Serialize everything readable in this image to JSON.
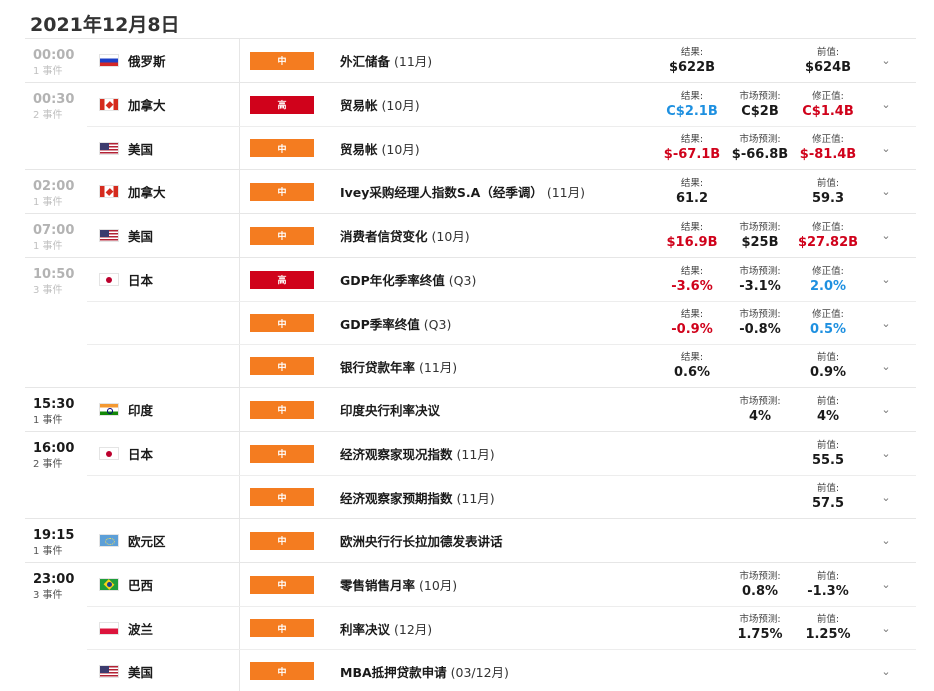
{
  "page_title": "2021年12月8日",
  "colors": {
    "impact_medium": "#f47c20",
    "impact_high": "#d0021b",
    "value_neutral": "#1a1a1a",
    "value_red": "#d0021b",
    "value_blue": "#1e90e0"
  },
  "groups": [
    {
      "time": "00:00",
      "count": "1 事件",
      "past": true,
      "events": [
        {
          "country": "俄罗斯",
          "flag": "ru",
          "impact": "中",
          "impact_level": "medium",
          "title": "外汇储备",
          "period": " (11月)",
          "values": [
            {
              "label": "结果:",
              "value": "$622B",
              "tone": "neutral"
            },
            null,
            {
              "label": "前值:",
              "value": "$624B",
              "tone": "neutral"
            }
          ]
        }
      ]
    },
    {
      "time": "00:30",
      "count": "2 事件",
      "past": true,
      "events": [
        {
          "country": "加拿大",
          "flag": "ca",
          "impact": "高",
          "impact_level": "high",
          "title": "贸易帐",
          "period": " (10月)",
          "values": [
            {
              "label": "结果:",
              "value": "C$2.1B",
              "tone": "blue"
            },
            {
              "label": "市场预测:",
              "value": "C$2B",
              "tone": "neutral"
            },
            {
              "label": "修正值:",
              "value": "C$1.4B",
              "tone": "red"
            }
          ]
        },
        {
          "country": "美国",
          "flag": "us",
          "impact": "中",
          "impact_level": "medium",
          "title": "贸易帐",
          "period": " (10月)",
          "values": [
            {
              "label": "结果:",
              "value": "$-67.1B",
              "tone": "red"
            },
            {
              "label": "市场预测:",
              "value": "$-66.8B",
              "tone": "neutral"
            },
            {
              "label": "修正值:",
              "value": "$-81.4B",
              "tone": "red"
            }
          ]
        }
      ]
    },
    {
      "time": "02:00",
      "count": "1 事件",
      "past": true,
      "events": [
        {
          "country": "加拿大",
          "flag": "ca",
          "impact": "中",
          "impact_level": "medium",
          "title": "Ivey采购经理人指数S.A（经季调）",
          "period": " (11月)",
          "values": [
            {
              "label": "结果:",
              "value": "61.2",
              "tone": "neutral"
            },
            null,
            {
              "label": "前值:",
              "value": "59.3",
              "tone": "neutral"
            }
          ]
        }
      ]
    },
    {
      "time": "07:00",
      "count": "1 事件",
      "past": true,
      "events": [
        {
          "country": "美国",
          "flag": "us",
          "impact": "中",
          "impact_level": "medium",
          "title": "消费者信贷变化",
          "period": " (10月)",
          "values": [
            {
              "label": "结果:",
              "value": "$16.9B",
              "tone": "red"
            },
            {
              "label": "市场预测:",
              "value": "$25B",
              "tone": "neutral"
            },
            {
              "label": "修正值:",
              "value": "$27.82B",
              "tone": "red"
            }
          ]
        }
      ]
    },
    {
      "time": "10:50",
      "count": "3 事件",
      "past": true,
      "events": [
        {
          "country": "日本",
          "flag": "jp",
          "impact": "高",
          "impact_level": "high",
          "title": "GDP年化季率终值",
          "period": " (Q3)",
          "values": [
            {
              "label": "结果:",
              "value": "-3.6%",
              "tone": "red"
            },
            {
              "label": "市场预测:",
              "value": "-3.1%",
              "tone": "neutral"
            },
            {
              "label": "修正值:",
              "value": "2.0%",
              "tone": "blue"
            }
          ]
        },
        {
          "country": "",
          "flag": "",
          "impact": "中",
          "impact_level": "medium",
          "title": "GDP季率终值",
          "period": " (Q3)",
          "values": [
            {
              "label": "结果:",
              "value": "-0.9%",
              "tone": "red"
            },
            {
              "label": "市场预测:",
              "value": "-0.8%",
              "tone": "neutral"
            },
            {
              "label": "修正值:",
              "value": "0.5%",
              "tone": "blue"
            }
          ]
        },
        {
          "country": "",
          "flag": "",
          "impact": "中",
          "impact_level": "medium",
          "title": "银行贷款年率",
          "period": " (11月)",
          "values": [
            {
              "label": "结果:",
              "value": "0.6%",
              "tone": "neutral"
            },
            null,
            {
              "label": "前值:",
              "value": "0.9%",
              "tone": "neutral"
            }
          ]
        }
      ]
    },
    {
      "time": "15:30",
      "count": "1 事件",
      "past": false,
      "events": [
        {
          "country": "印度",
          "flag": "in",
          "impact": "中",
          "impact_level": "medium",
          "title": "印度央行利率决议",
          "period": "",
          "values": [
            null,
            {
              "label": "市场预测:",
              "value": "4%",
              "tone": "neutral"
            },
            {
              "label": "前值:",
              "value": "4%",
              "tone": "neutral"
            }
          ]
        }
      ]
    },
    {
      "time": "16:00",
      "count": "2 事件",
      "past": false,
      "events": [
        {
          "country": "日本",
          "flag": "jp",
          "impact": "中",
          "impact_level": "medium",
          "title": "经济观察家现况指数",
          "period": " (11月)",
          "values": [
            null,
            null,
            {
              "label": "前值:",
              "value": "55.5",
              "tone": "neutral"
            }
          ]
        },
        {
          "country": "",
          "flag": "",
          "impact": "中",
          "impact_level": "medium",
          "title": "经济观察家预期指数",
          "period": " (11月)",
          "values": [
            null,
            null,
            {
              "label": "前值:",
              "value": "57.5",
              "tone": "neutral"
            }
          ]
        }
      ]
    },
    {
      "time": "19:15",
      "count": "1 事件",
      "past": false,
      "events": [
        {
          "country": "欧元区",
          "flag": "eu",
          "impact": "中",
          "impact_level": "medium",
          "title": "欧洲央行行长拉加德发表讲话",
          "period": "",
          "values": [
            null,
            null,
            null
          ]
        }
      ]
    },
    {
      "time": "23:00",
      "count": "3 事件",
      "past": false,
      "events": [
        {
          "country": "巴西",
          "flag": "br",
          "impact": "中",
          "impact_level": "medium",
          "title": "零售销售月率",
          "period": " (10月)",
          "values": [
            null,
            {
              "label": "市场预测:",
              "value": "0.8%",
              "tone": "neutral"
            },
            {
              "label": "前值:",
              "value": "-1.3%",
              "tone": "neutral"
            }
          ]
        },
        {
          "country": "波兰",
          "flag": "pl",
          "impact": "中",
          "impact_level": "medium",
          "title": "利率决议",
          "period": " (12月)",
          "values": [
            null,
            {
              "label": "市场预测:",
              "value": "1.75%",
              "tone": "neutral"
            },
            {
              "label": "前值:",
              "value": "1.25%",
              "tone": "neutral"
            }
          ]
        },
        {
          "country": "美国",
          "flag": "us",
          "impact": "中",
          "impact_level": "medium",
          "title": "MBA抵押贷款申请",
          "period": " (03/12月)",
          "values": [
            null,
            null,
            null
          ]
        }
      ]
    }
  ],
  "expand_icon": "chevron-down-icon"
}
